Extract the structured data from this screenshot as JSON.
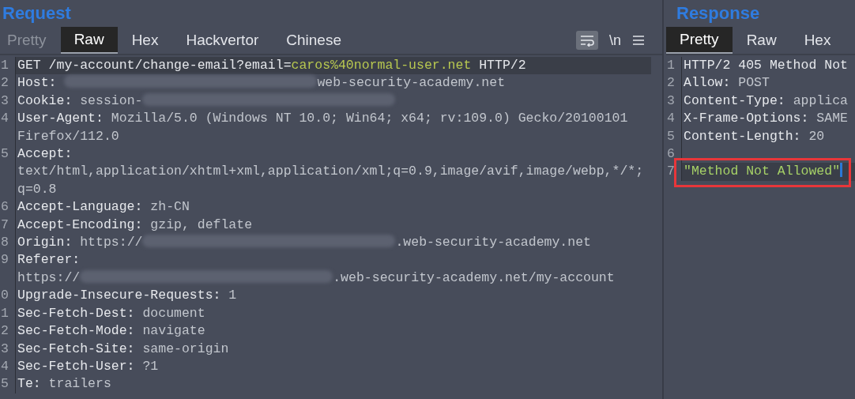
{
  "request": {
    "title": "Request",
    "tabs": [
      {
        "label": "Pretty",
        "selected": false,
        "disabled": true
      },
      {
        "label": "Raw",
        "selected": true,
        "disabled": false
      },
      {
        "label": "Hex",
        "selected": false,
        "disabled": false
      },
      {
        "label": "Hackvertor",
        "selected": false,
        "disabled": false
      },
      {
        "label": "Chinese",
        "selected": false,
        "disabled": false
      }
    ],
    "toolbar": {
      "wrap_on": true,
      "newline_label": "\\n"
    },
    "rows": [
      {
        "n": "1",
        "highlighted": true,
        "parts": [
          {
            "kind": "key",
            "text": "GET /my-account/change-email?email="
          },
          {
            "kind": "param",
            "text": "caros%40normal-user.net"
          },
          {
            "kind": "key",
            "text": " HTTP/2"
          }
        ]
      },
      {
        "n": "2",
        "highlighted": false,
        "parts": [
          {
            "kind": "key",
            "text": "Host: "
          },
          {
            "kind": "redacted"
          },
          {
            "kind": "value",
            "text": "web-security-academy.net"
          }
        ]
      },
      {
        "n": "3",
        "highlighted": false,
        "parts": [
          {
            "kind": "key",
            "text": "Cookie: "
          },
          {
            "kind": "value",
            "text": "session-"
          },
          {
            "kind": "redacted"
          }
        ]
      },
      {
        "n": "4",
        "highlighted": false,
        "parts": [
          {
            "kind": "key",
            "text": "User-Agent: "
          },
          {
            "kind": "value",
            "text": "Mozilla/5.0 (Windows NT 10.0; Win64; x64; rv:109.0) Gecko/20100101"
          }
        ]
      },
      {
        "highlighted": false,
        "parts": [
          {
            "kind": "value",
            "text": "Firefox/112.0"
          }
        ]
      },
      {
        "n": "5",
        "highlighted": false,
        "parts": [
          {
            "kind": "key",
            "text": "Accept:"
          }
        ]
      },
      {
        "highlighted": false,
        "parts": [
          {
            "kind": "value",
            "text": "text/html,application/xhtml+xml,application/xml;q=0.9,image/avif,image/webp,*/*;"
          }
        ]
      },
      {
        "highlighted": false,
        "parts": [
          {
            "kind": "value",
            "text": "q=0.8"
          }
        ]
      },
      {
        "n": "6",
        "highlighted": false,
        "parts": [
          {
            "kind": "key",
            "text": "Accept-Language: "
          },
          {
            "kind": "value",
            "text": "zh-CN"
          }
        ]
      },
      {
        "n": "7",
        "highlighted": false,
        "parts": [
          {
            "kind": "key",
            "text": "Accept-Encoding: "
          },
          {
            "kind": "value",
            "text": "gzip, deflate"
          }
        ]
      },
      {
        "n": "8",
        "highlighted": false,
        "parts": [
          {
            "kind": "key",
            "text": "Origin: "
          },
          {
            "kind": "value",
            "text": "https://"
          },
          {
            "kind": "redacted"
          },
          {
            "kind": "value",
            "text": ".web-security-academy.net"
          }
        ]
      },
      {
        "n": "9",
        "highlighted": false,
        "parts": [
          {
            "kind": "key",
            "text": "Referer:"
          }
        ]
      },
      {
        "highlighted": false,
        "parts": [
          {
            "kind": "value",
            "text": "https://"
          },
          {
            "kind": "redacted"
          },
          {
            "kind": "value",
            "text": ".web-security-academy.net/my-account"
          }
        ]
      },
      {
        "n": "0",
        "highlighted": false,
        "parts": [
          {
            "kind": "key",
            "text": "Upgrade-Insecure-Requests: "
          },
          {
            "kind": "value",
            "text": "1"
          }
        ]
      },
      {
        "n": "1",
        "highlighted": false,
        "parts": [
          {
            "kind": "key",
            "text": "Sec-Fetch-Dest: "
          },
          {
            "kind": "value",
            "text": "document"
          }
        ]
      },
      {
        "n": "2",
        "highlighted": false,
        "parts": [
          {
            "kind": "key",
            "text": "Sec-Fetch-Mode: "
          },
          {
            "kind": "value",
            "text": "navigate"
          }
        ]
      },
      {
        "n": "3",
        "highlighted": false,
        "parts": [
          {
            "kind": "key",
            "text": "Sec-Fetch-Site: "
          },
          {
            "kind": "value",
            "text": "same-origin"
          }
        ]
      },
      {
        "n": "4",
        "highlighted": false,
        "parts": [
          {
            "kind": "key",
            "text": "Sec-Fetch-User: "
          },
          {
            "kind": "value",
            "text": "?1"
          }
        ]
      },
      {
        "n": "5",
        "highlighted": false,
        "parts": [
          {
            "kind": "key",
            "text": "Te: "
          },
          {
            "kind": "value",
            "text": "trailers"
          }
        ]
      }
    ]
  },
  "response": {
    "title": "Response",
    "tabs": [
      {
        "label": "Pretty",
        "selected": true,
        "disabled": false
      },
      {
        "label": "Raw",
        "selected": false,
        "disabled": false
      },
      {
        "label": "Hex",
        "selected": false,
        "disabled": false
      }
    ],
    "rows": [
      {
        "n": "1",
        "highlighted": false,
        "boxed": false,
        "parts": [
          {
            "kind": "key",
            "text": "HTTP/2 405 Method Not"
          }
        ]
      },
      {
        "n": "2",
        "highlighted": false,
        "boxed": false,
        "parts": [
          {
            "kind": "key",
            "text": "Allow: "
          },
          {
            "kind": "value",
            "text": "POST"
          }
        ]
      },
      {
        "n": "3",
        "highlighted": false,
        "boxed": false,
        "parts": [
          {
            "kind": "key",
            "text": "Content-Type: "
          },
          {
            "kind": "value",
            "text": "applica"
          }
        ]
      },
      {
        "n": "4",
        "highlighted": false,
        "boxed": false,
        "parts": [
          {
            "kind": "key",
            "text": "X-Frame-Options: "
          },
          {
            "kind": "value",
            "text": "SAME"
          }
        ]
      },
      {
        "n": "5",
        "highlighted": false,
        "boxed": false,
        "parts": [
          {
            "kind": "key",
            "text": "Content-Length: "
          },
          {
            "kind": "value",
            "text": "20"
          }
        ]
      },
      {
        "n": "6",
        "highlighted": false,
        "boxed": false,
        "parts": []
      },
      {
        "n": "7",
        "highlighted": true,
        "boxed": true,
        "parts": [
          {
            "kind": "string",
            "text": "\"Method Not Allowed\""
          }
        ]
      }
    ]
  }
}
